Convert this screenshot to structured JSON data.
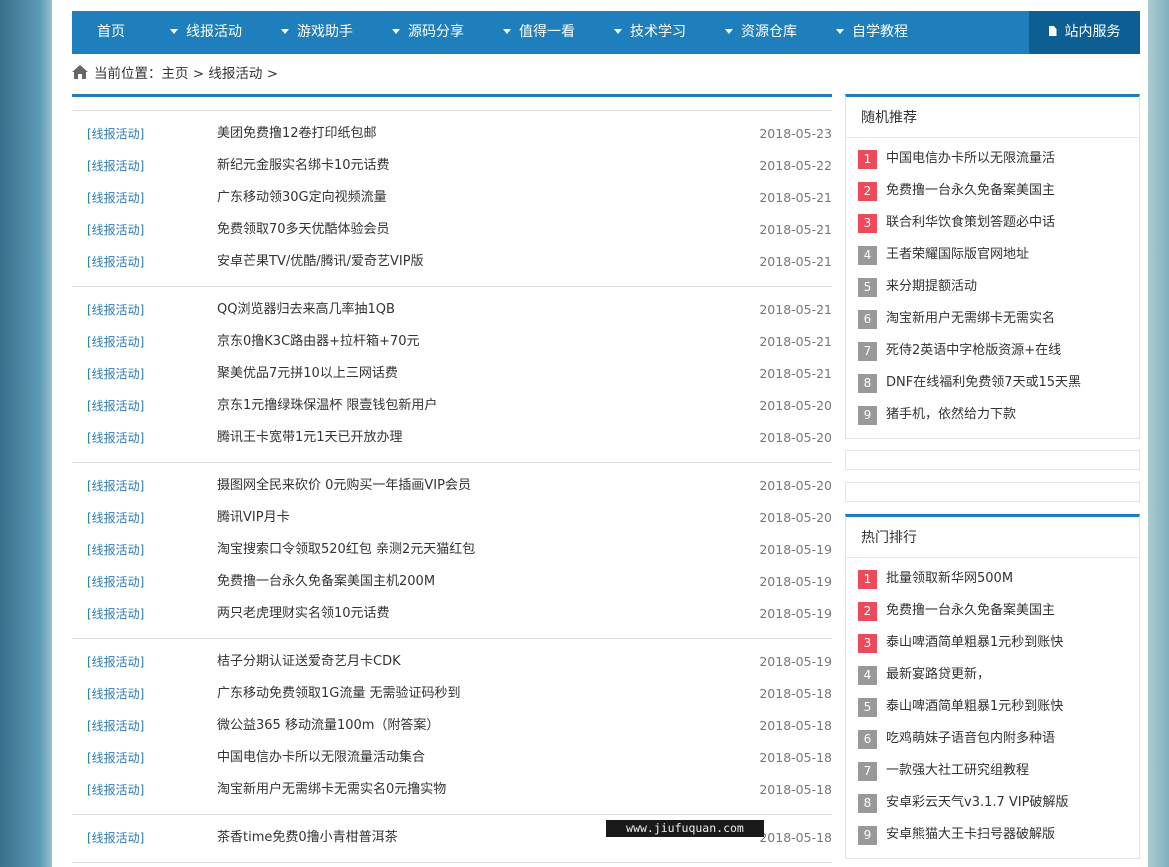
{
  "nav": {
    "items": [
      {
        "label": "首页",
        "arrow": false
      },
      {
        "label": "线报活动",
        "arrow": true
      },
      {
        "label": "游戏助手",
        "arrow": true
      },
      {
        "label": "源码分享",
        "arrow": true
      },
      {
        "label": "值得一看",
        "arrow": true
      },
      {
        "label": "技术学习",
        "arrow": true
      },
      {
        "label": "资源仓库",
        "arrow": true
      },
      {
        "label": "自学教程",
        "arrow": true
      }
    ],
    "service_label": "站内服务"
  },
  "breadcrumb": {
    "prefix": "当前位置：",
    "home": "主页",
    "sep1": " > ",
    "current": "线报活动",
    "sep2": " >"
  },
  "posts": [
    [
      {
        "cat": "[线报活动]",
        "title": "美团免费撸12卷打印纸包邮",
        "date": "2018-05-23"
      },
      {
        "cat": "[线报活动]",
        "title": "新纪元金服实名绑卡10元话费",
        "date": "2018-05-22"
      },
      {
        "cat": "[线报活动]",
        "title": "广东移动领30G定向视频流量",
        "date": "2018-05-21"
      },
      {
        "cat": "[线报活动]",
        "title": "免费领取70多天优酷体验会员",
        "date": "2018-05-21"
      },
      {
        "cat": "[线报活动]",
        "title": "安卓芒果TV/优酷/腾讯/爱奇艺VIP版",
        "date": "2018-05-21"
      }
    ],
    [
      {
        "cat": "[线报活动]",
        "title": "QQ浏览器归去来高几率抽1QB",
        "date": "2018-05-21"
      },
      {
        "cat": "[线报活动]",
        "title": "京东0撸K3C路由器+拉杆箱+70元",
        "date": "2018-05-21"
      },
      {
        "cat": "[线报活动]",
        "title": "聚美优品7元拼10以上三网话费",
        "date": "2018-05-21"
      },
      {
        "cat": "[线报活动]",
        "title": "京东1元撸绿珠保温杯 限壹钱包新用户",
        "date": "2018-05-20"
      },
      {
        "cat": "[线报活动]",
        "title": "腾讯王卡宽带1元1天已开放办理",
        "date": "2018-05-20"
      }
    ],
    [
      {
        "cat": "[线报活动]",
        "title": "摄图网全民来砍价 0元购买一年插画VIP会员",
        "date": "2018-05-20"
      },
      {
        "cat": "[线报活动]",
        "title": "腾讯VIP月卡",
        "date": "2018-05-20"
      },
      {
        "cat": "[线报活动]",
        "title": "淘宝搜索口令领取520红包 亲测2元天猫红包",
        "date": "2018-05-19"
      },
      {
        "cat": "[线报活动]",
        "title": "免费撸一台永久免备案美国主机200M",
        "date": "2018-05-19"
      },
      {
        "cat": "[线报活动]",
        "title": "两只老虎理财实名领10元话费",
        "date": "2018-05-19"
      }
    ],
    [
      {
        "cat": "[线报活动]",
        "title": "桔子分期认证送爱奇艺月卡CDK",
        "date": "2018-05-19"
      },
      {
        "cat": "[线报活动]",
        "title": "广东移动免费领取1G流量 无需验证码秒到",
        "date": "2018-05-18"
      },
      {
        "cat": "[线报活动]",
        "title": "微公益365 移动流量100m（附答案）",
        "date": "2018-05-18"
      },
      {
        "cat": "[线报活动]",
        "title": "中国电信办卡所以无限流量活动集合",
        "date": "2018-05-18"
      },
      {
        "cat": "[线报活动]",
        "title": "淘宝新用户无需绑卡无需实名0元撸实物",
        "date": "2018-05-18"
      }
    ],
    [
      {
        "cat": "[线报活动]",
        "title": "茶香time免费0撸小青柑普洱茶",
        "date": "2018-05-18"
      }
    ]
  ],
  "random": {
    "title": "随机推荐",
    "items": [
      {
        "num": "1",
        "text": "中国电信办卡所以无限流量活"
      },
      {
        "num": "2",
        "text": "免费撸一台永久免备案美国主"
      },
      {
        "num": "3",
        "text": "联合利华饮食策划答题必中话"
      },
      {
        "num": "4",
        "text": "王者荣耀国际版官网地址"
      },
      {
        "num": "5",
        "text": "来分期提额活动"
      },
      {
        "num": "6",
        "text": "淘宝新用户无需绑卡无需实名"
      },
      {
        "num": "7",
        "text": "死侍2英语中字枪版资源+在线"
      },
      {
        "num": "8",
        "text": "DNF在线福利免费领7天或15天黑"
      },
      {
        "num": "9",
        "text": "猪手机，依然给力下款"
      }
    ]
  },
  "hot": {
    "title": "热门排行",
    "items": [
      {
        "num": "1",
        "text": "批量领取新华网500M"
      },
      {
        "num": "2",
        "text": "免费撸一台永久免备案美国主"
      },
      {
        "num": "3",
        "text": "泰山啤酒简单粗暴1元秒到账快"
      },
      {
        "num": "4",
        "text": "最新宴路贷更新，"
      },
      {
        "num": "5",
        "text": "泰山啤酒简单粗暴1元秒到账快"
      },
      {
        "num": "6",
        "text": "吃鸡萌妹子语音包内附多种语"
      },
      {
        "num": "7",
        "text": "一款强大社工研究组教程"
      },
      {
        "num": "8",
        "text": "安卓彩云天气v3.1.7 VIP破解版"
      },
      {
        "num": "9",
        "text": "安卓熊猫大王卡扫号器破解版"
      }
    ]
  },
  "watermark": "www.jiufuquan.com",
  "colors": {
    "nav": "#1e7fbc",
    "nav_service": "#0d5f93",
    "hot_num": "#ee4a5a",
    "cat_link": "#2a7db6"
  }
}
